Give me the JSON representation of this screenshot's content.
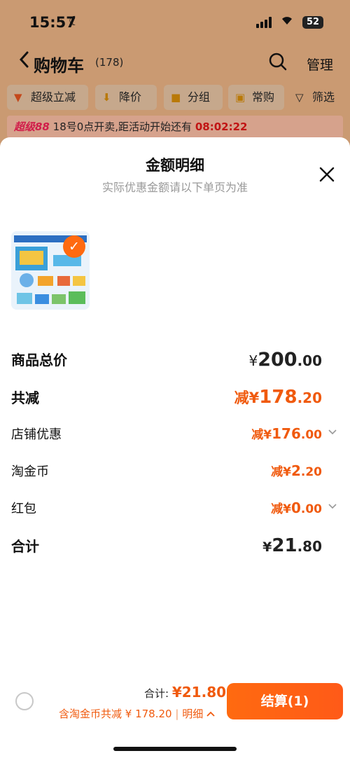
{
  "status_bar": {
    "time": "15:57",
    "battery": "52"
  },
  "nav": {
    "back_icon": "chevron-left-icon",
    "title": "购物车",
    "count": "(178)",
    "search_icon": "search-icon",
    "manage": "管理"
  },
  "filters": [
    {
      "label": "超级立减",
      "icon": "down-arrow-icon"
    },
    {
      "label": "降价",
      "icon": "down-arrow-icon"
    },
    {
      "label": "分组",
      "icon": "folder-icon"
    },
    {
      "label": "常购",
      "icon": "cart-icon"
    },
    {
      "label": "筛选",
      "icon": "filter-icon"
    }
  ],
  "promo": {
    "brand": "超级88",
    "text": "18号0点开卖,距活动开始还有",
    "countdown": "08:02:22"
  },
  "sheet": {
    "title": "金额明细",
    "subtitle": "实际优惠金额请以下单页为准",
    "rows": [
      {
        "label": "商品总价",
        "prefix": "¥",
        "int": "200",
        "dec": ".00"
      },
      {
        "label": "共减",
        "prefix": "减¥",
        "int": "178",
        "dec": ".20"
      },
      {
        "label": "店铺优惠",
        "prefix": "减¥",
        "int": "176",
        "dec": ".00"
      },
      {
        "label": "淘金币",
        "prefix": "减¥",
        "int": "2",
        "dec": ".20"
      },
      {
        "label": "红包",
        "prefix": "减¥",
        "int": "0",
        "dec": ".00"
      },
      {
        "label": "合计",
        "prefix": "¥",
        "int": "21",
        "dec": ".80"
      }
    ]
  },
  "bottom": {
    "total_label": "合计:",
    "total_value": "¥21.80",
    "sub_text": "含淘金币共减 ¥ 178.20",
    "detail_label": "明细",
    "pay_label": "结算(1)"
  },
  "colors": {
    "accent": "#f05a0e",
    "header_bg": "#ca9a72"
  }
}
